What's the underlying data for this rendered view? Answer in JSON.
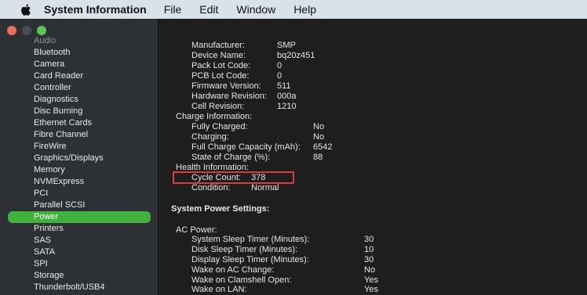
{
  "menubar": {
    "app_name": "System Information",
    "items": [
      "File",
      "Edit",
      "Window",
      "Help"
    ]
  },
  "sidebar": {
    "items": [
      {
        "label": "Audio",
        "clipped": true
      },
      {
        "label": "Bluetooth"
      },
      {
        "label": "Camera"
      },
      {
        "label": "Card Reader"
      },
      {
        "label": "Controller"
      },
      {
        "label": "Diagnostics"
      },
      {
        "label": "Disc Burning"
      },
      {
        "label": "Ethernet Cards"
      },
      {
        "label": "Fibre Channel"
      },
      {
        "label": "FireWire"
      },
      {
        "label": "Graphics/Displays"
      },
      {
        "label": "Memory"
      },
      {
        "label": "NVMExpress"
      },
      {
        "label": "PCI"
      },
      {
        "label": "Parallel SCSI"
      },
      {
        "label": "Power",
        "selected": true
      },
      {
        "label": "Printers"
      },
      {
        "label": "SAS"
      },
      {
        "label": "SATA"
      },
      {
        "label": "SPI"
      },
      {
        "label": "Storage"
      },
      {
        "label": "Thunderbolt/USB4"
      }
    ]
  },
  "details": {
    "battery": [
      {
        "label": "Manufacturer:",
        "value": "SMP"
      },
      {
        "label": "Device Name:",
        "value": "bq20z451"
      },
      {
        "label": "Pack Lot Code:",
        "value": "0"
      },
      {
        "label": "PCB Lot Code:",
        "value": "0"
      },
      {
        "label": "Firmware Version:",
        "value": "511"
      },
      {
        "label": "Hardware Revision:",
        "value": "000a"
      },
      {
        "label": "Cell Revision:",
        "value": "1210"
      }
    ],
    "charge_heading": "Charge Information:",
    "charge": [
      {
        "label": "Fully Charged:",
        "value": "No"
      },
      {
        "label": "Charging:",
        "value": "No"
      },
      {
        "label": "Full Charge Capacity (mAh):",
        "value": "6542"
      },
      {
        "label": "State of Charge (%):",
        "value": "88"
      }
    ],
    "health_heading": "Health Information:",
    "health": [
      {
        "label": "Cycle Count:",
        "value": "378"
      },
      {
        "label": "Condition:",
        "value": "Normal"
      }
    ],
    "power_settings_heading": "System Power Settings:",
    "ac_heading": "AC Power:",
    "ac": [
      {
        "label": "System Sleep Timer (Minutes):",
        "value": "30"
      },
      {
        "label": "Disk Sleep Timer (Minutes):",
        "value": "10"
      },
      {
        "label": "Display Sleep Timer (Minutes):",
        "value": "30"
      },
      {
        "label": "Wake on AC Change:",
        "value": "No"
      },
      {
        "label": "Wake on Clamshell Open:",
        "value": "Yes"
      },
      {
        "label": "Wake on LAN:",
        "value": "Yes"
      }
    ]
  },
  "colors": {
    "selection": "#3fb33c",
    "highlight_box": "#e0393a"
  }
}
